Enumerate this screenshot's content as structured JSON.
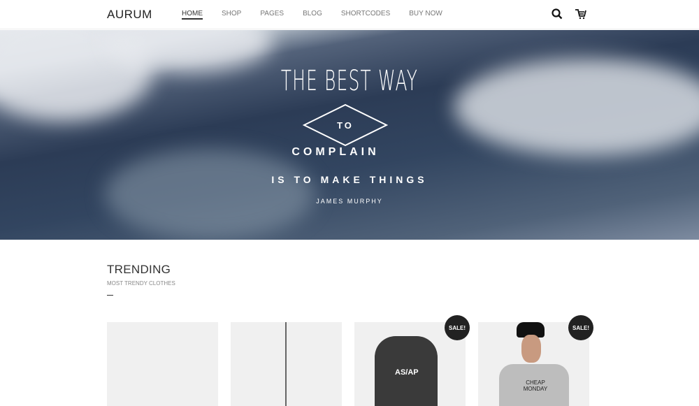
{
  "header": {
    "logo": "AURUM",
    "nav": [
      {
        "label": "HOME",
        "active": true
      },
      {
        "label": "SHOP"
      },
      {
        "label": "PAGES"
      },
      {
        "label": "BLOG"
      },
      {
        "label": "SHORTCODES"
      },
      {
        "label": "BUY NOW"
      }
    ],
    "icons": [
      "search-icon",
      "cart-icon"
    ]
  },
  "hero": {
    "line1": "THE BEST WAY",
    "line2": "TO",
    "line3": "COMPLAIN",
    "line4": "IS TO MAKE THINGS",
    "author": "JAMES MURPHY"
  },
  "trending": {
    "title": "TRENDING",
    "subtitle": "MOST TRENDY CLOTHES",
    "products": [
      {
        "sale": false
      },
      {
        "sale": false
      },
      {
        "sale": true,
        "badge": "SALE!",
        "print": "AS/AP"
      },
      {
        "sale": true,
        "badge": "SALE!",
        "print": "CHEAP MONDAY"
      }
    ]
  }
}
